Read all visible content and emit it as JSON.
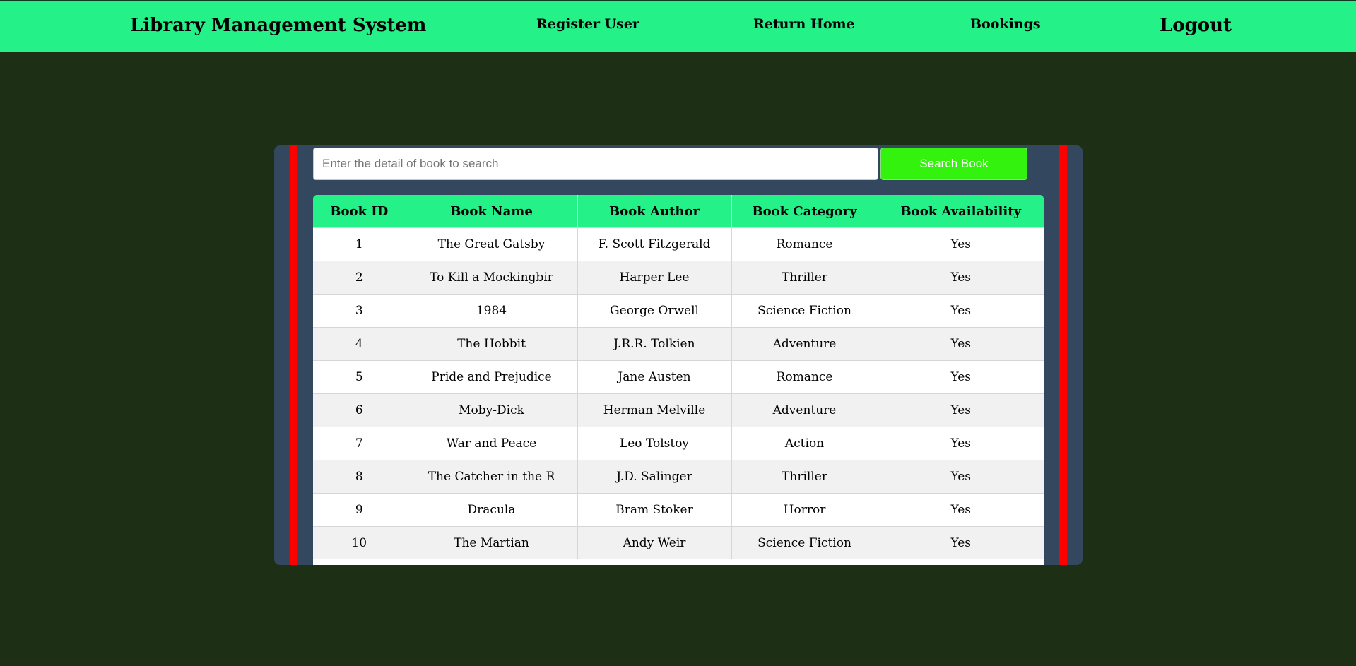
{
  "header": {
    "brand": "Library Management System",
    "nav": {
      "register": "Register User",
      "home": "Return Home",
      "bookings": "Bookings",
      "logout": "Logout"
    }
  },
  "search": {
    "placeholder": "Enter the detail of book to search",
    "value": "",
    "button_label": "Search Book"
  },
  "table": {
    "columns": [
      "Book ID",
      "Book Name",
      "Book Author",
      "Book Category",
      "Book Availability"
    ],
    "rows": [
      [
        "1",
        "The Great Gatsby",
        "F. Scott Fitzgerald",
        "Romance",
        "Yes"
      ],
      [
        "2",
        "To Kill a Mockingbir",
        "Harper Lee",
        "Thriller",
        "Yes"
      ],
      [
        "3",
        "1984",
        "George Orwell",
        "Science Fiction",
        "Yes"
      ],
      [
        "4",
        "The Hobbit",
        "J.R.R. Tolkien",
        "Adventure",
        "Yes"
      ],
      [
        "5",
        "Pride and Prejudice",
        "Jane Austen",
        "Romance",
        "Yes"
      ],
      [
        "6",
        "Moby-Dick",
        "Herman Melville",
        "Adventure",
        "Yes"
      ],
      [
        "7",
        "War and Peace",
        "Leo Tolstoy",
        "Action",
        "Yes"
      ],
      [
        "8",
        "The Catcher in the R",
        "J.D. Salinger",
        "Thriller",
        "Yes"
      ],
      [
        "9",
        "Dracula",
        "Bram Stoker",
        "Horror",
        "Yes"
      ],
      [
        "10",
        "The Martian",
        "Andy Weir",
        "Science Fiction",
        "Yes"
      ]
    ]
  },
  "colors": {
    "header_bg": "#24f289",
    "page_bg": "#1d3015",
    "panel_bg": "#33475e",
    "accent_red": "#ff0000",
    "search_button_bg": "#33f20e"
  }
}
